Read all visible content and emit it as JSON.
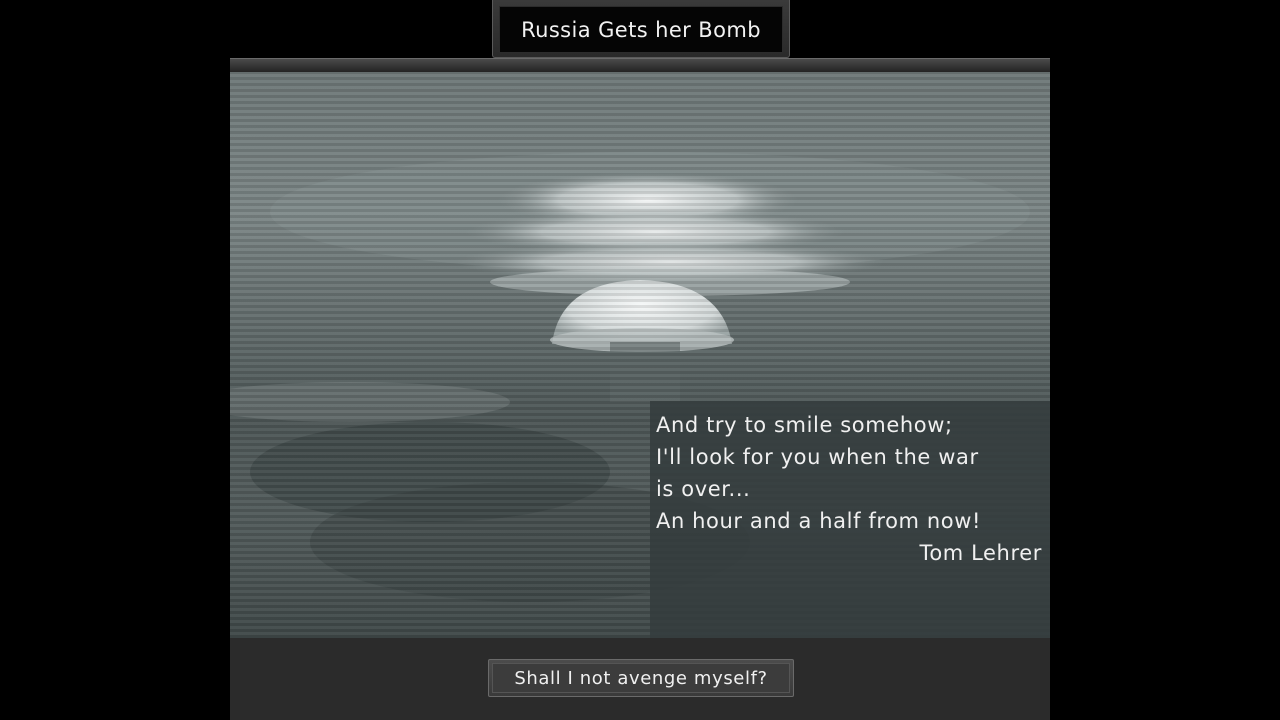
{
  "event": {
    "title": "Russia Gets her Bomb",
    "quote_lines": [
      "And try to smile somehow;",
      "I'll look for you when the war",
      "is over...",
      "An hour and a half from now!"
    ],
    "quote_author": "Tom Lehrer",
    "option_label": "Shall I not avenge myself?",
    "image_subject": "mushroom-cloud-photo"
  }
}
